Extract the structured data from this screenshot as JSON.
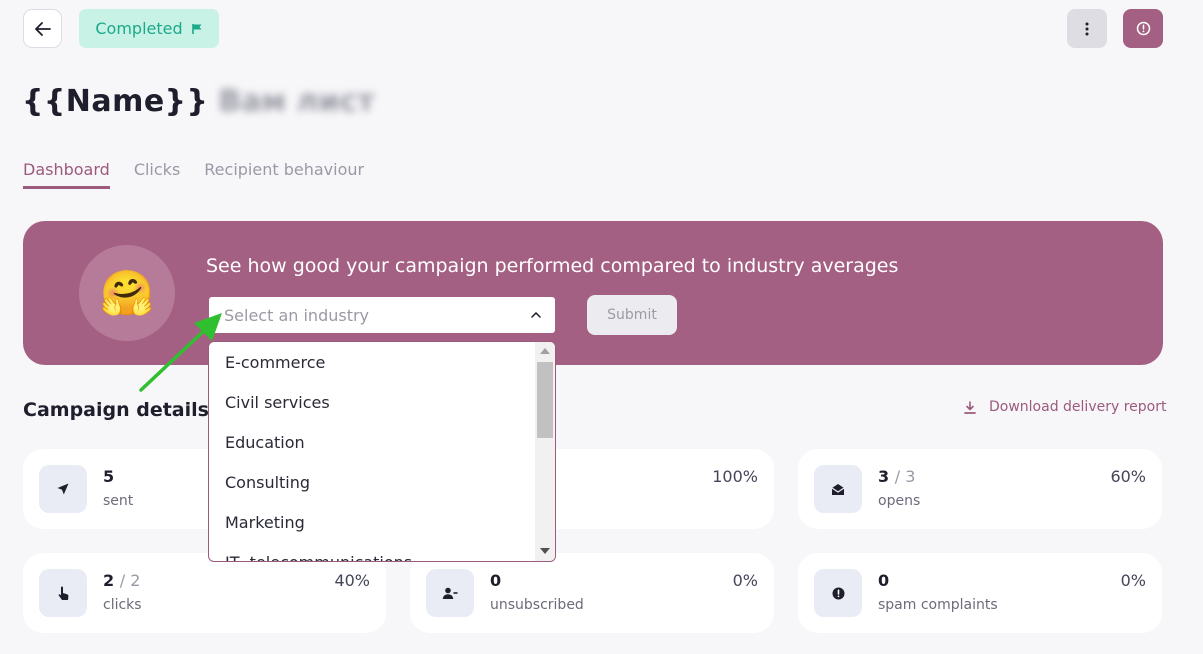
{
  "header": {
    "status_label": "Completed",
    "title": "{{Name}}",
    "title_blurred": "Вам лист"
  },
  "tabs": [
    {
      "label": "Dashboard",
      "active": true
    },
    {
      "label": "Clicks",
      "active": false
    },
    {
      "label": "Recipient behaviour",
      "active": false
    }
  ],
  "banner": {
    "emoji": "🤗",
    "text": "See how good your campaign performed compared to industry averages",
    "select_placeholder": "Select an industry",
    "submit_label": "Submit"
  },
  "dropdown": {
    "options": [
      "E-commerce",
      "Civil services",
      "Education",
      "Consulting",
      "Marketing",
      "IT, telecommunications"
    ]
  },
  "campaign": {
    "title": "Campaign details",
    "download_label": "Download delivery report"
  },
  "stats": [
    {
      "id": "sent",
      "value": "5",
      "denominator": "",
      "label": "sent",
      "pct": ""
    },
    {
      "id": "delivered",
      "value": "",
      "denominator": "",
      "label": "",
      "pct": "100%"
    },
    {
      "id": "opens",
      "value": "3",
      "denominator": "3",
      "label": "opens",
      "pct": "60%"
    },
    {
      "id": "clicks",
      "value": "2",
      "denominator": "2",
      "label": "clicks",
      "pct": "40%"
    },
    {
      "id": "unsubscribed",
      "value": "0",
      "denominator": "",
      "label": "unsubscribed",
      "pct": "0%"
    },
    {
      "id": "spam",
      "value": "0",
      "denominator": "",
      "label": "spam complaints",
      "pct": "0%"
    }
  ],
  "colors": {
    "accent": "#a46083",
    "status_bg": "#c9f2e6",
    "status_text": "#1ba98a",
    "annotation_arrow": "#2fbf2f"
  }
}
